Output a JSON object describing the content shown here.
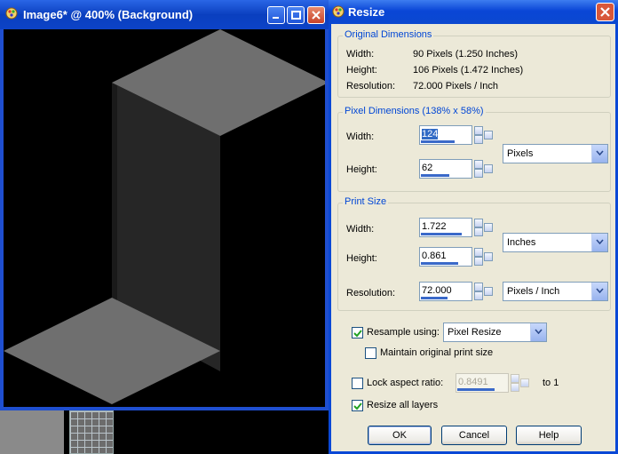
{
  "image_window": {
    "title": "Image6* @ 400% (Background)"
  },
  "dialog": {
    "title": "Resize",
    "original": {
      "group_title": "Original Dimensions",
      "width_label": "Width:",
      "width_value": "90 Pixels (1.250 Inches)",
      "height_label": "Height:",
      "height_value": "106 Pixels (1.472 Inches)",
      "resolution_label": "Resolution:",
      "resolution_value": "72.000 Pixels / Inch"
    },
    "pixel_dims": {
      "group_title": "Pixel Dimensions (138% x 58%)",
      "width_label": "Width:",
      "width_value": "124",
      "height_label": "Height:",
      "height_value": "62",
      "unit": "Pixels"
    },
    "print_size": {
      "group_title": "Print Size",
      "width_label": "Width:",
      "width_value": "1.722",
      "height_label": "Height:",
      "height_value": "0.861",
      "unit": "Inches",
      "resolution_label": "Resolution:",
      "resolution_value": "72.000",
      "resolution_unit": "Pixels / Inch"
    },
    "options": {
      "resample_label": "Resample using:",
      "resample_checked": true,
      "resample_method": "Pixel Resize",
      "maintain_label": "Maintain original print size",
      "maintain_checked": false,
      "lock_label": "Lock aspect ratio:",
      "lock_checked": false,
      "lock_value": "0.8491",
      "lock_suffix": "to 1",
      "all_layers_label": "Resize all layers",
      "all_layers_checked": true
    },
    "buttons": {
      "ok": "OK",
      "cancel": "Cancel",
      "help": "Help"
    }
  },
  "colors": {
    "xp_title_blue": "#0a48d6",
    "dialog_face": "#ece9d8",
    "group_title_blue": "#0046d5"
  }
}
